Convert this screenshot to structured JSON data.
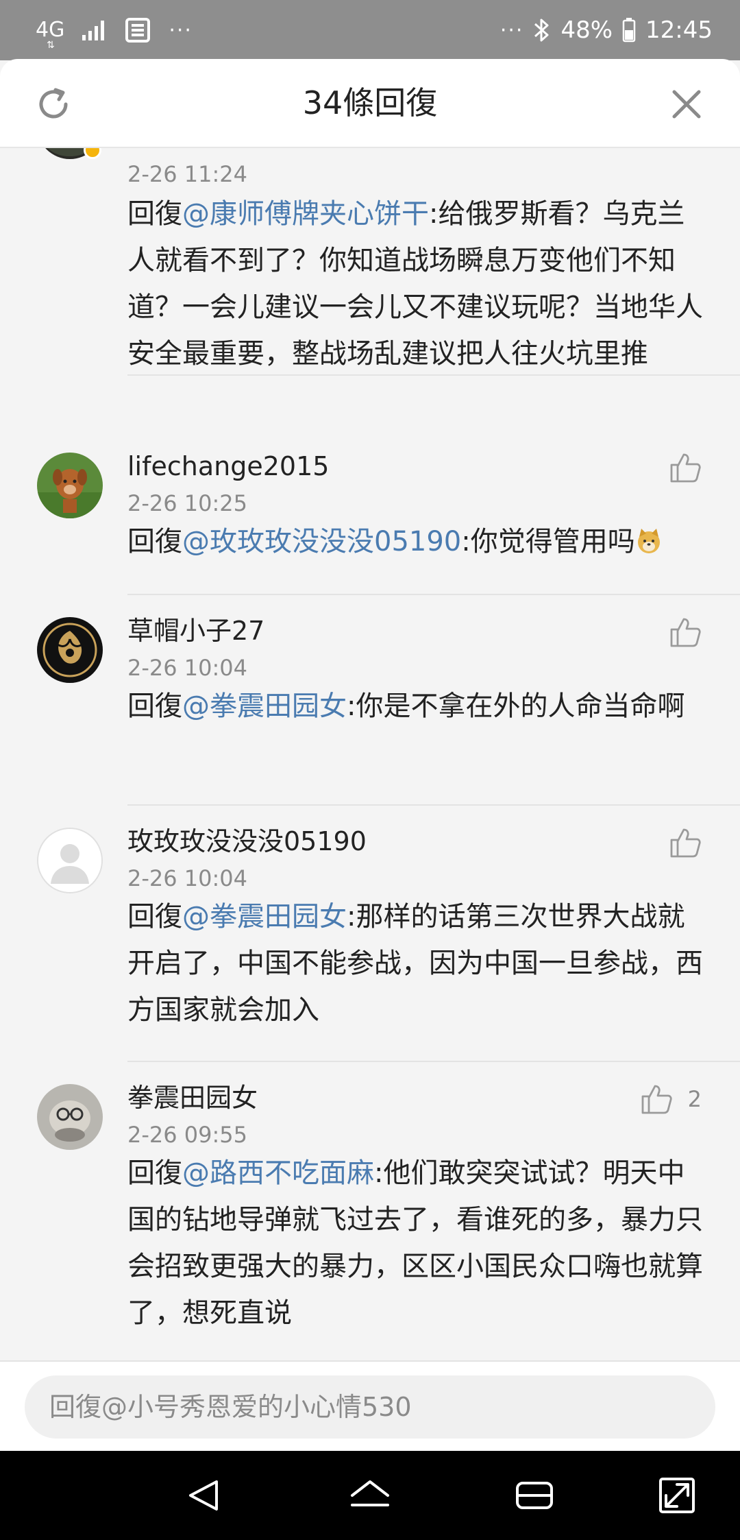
{
  "status_bar": {
    "network": "4G",
    "network_arrows": "⇅",
    "overflow_left": "···",
    "overflow_right": "···",
    "battery": "48%",
    "time": "12:45",
    "icons": [
      "signal-icon",
      "news-icon",
      "bluetooth-icon",
      "battery-icon"
    ]
  },
  "header": {
    "title": "34條回復",
    "refresh_icon": "refresh-icon",
    "close_icon": "close-icon"
  },
  "comments": [
    {
      "username": "",
      "verified": true,
      "timestamp": "2-26 11:24",
      "reply_prefix": "回復",
      "mention": "@康师傅牌夹心饼干",
      "text": ":给俄罗斯看？乌克兰人就看不到了？你知道战场瞬息万变他们不知道？一会儿建议一会儿又不建议玩呢？当地华人安全最重要，整战场乱建议把人往火坑里推",
      "likes": ""
    },
    {
      "username": "lifechange2015",
      "timestamp": "2-26 10:25",
      "reply_prefix": "回復",
      "mention": "@玫玫玫没没没05190",
      "text": ":你觉得管用吗",
      "emoji": "doge-emoji",
      "likes": ""
    },
    {
      "username": "草帽小子27",
      "timestamp": "2-26 10:04",
      "reply_prefix": "回復",
      "mention": "@拳震田园女",
      "text": ":你是不拿在外的人命当命啊",
      "likes": ""
    },
    {
      "username": "玫玫玫没没没05190",
      "timestamp": "2-26 10:04",
      "reply_prefix": "回復",
      "mention": "@拳震田园女",
      "text": ":那样的话第三次世界大战就开启了，中国不能参战，因为中国一旦参战，西方国家就会加入",
      "likes": ""
    },
    {
      "username": "拳震田园女",
      "timestamp": "2-26 09:55",
      "reply_prefix": "回復",
      "mention": "@路西不吃面麻",
      "text": ":他们敢突突试试？明天中国的钻地导弹就飞过去了，看谁死的多，暴力只会招致更强大的暴力，区区小国民众口嗨也就算了，想死直说",
      "likes": "2"
    }
  ],
  "reply_bar": {
    "placeholder": "回復@小号秀恩爱的小心情530"
  },
  "nav_bar": {
    "icons": [
      "back-icon",
      "home-icon",
      "recents-icon",
      "expand-icon"
    ]
  },
  "colors": {
    "mention": "#4a7bb0",
    "status_bar": "#8e8e8e",
    "background": "#f4f4f4",
    "badge": "#f5b40c"
  }
}
